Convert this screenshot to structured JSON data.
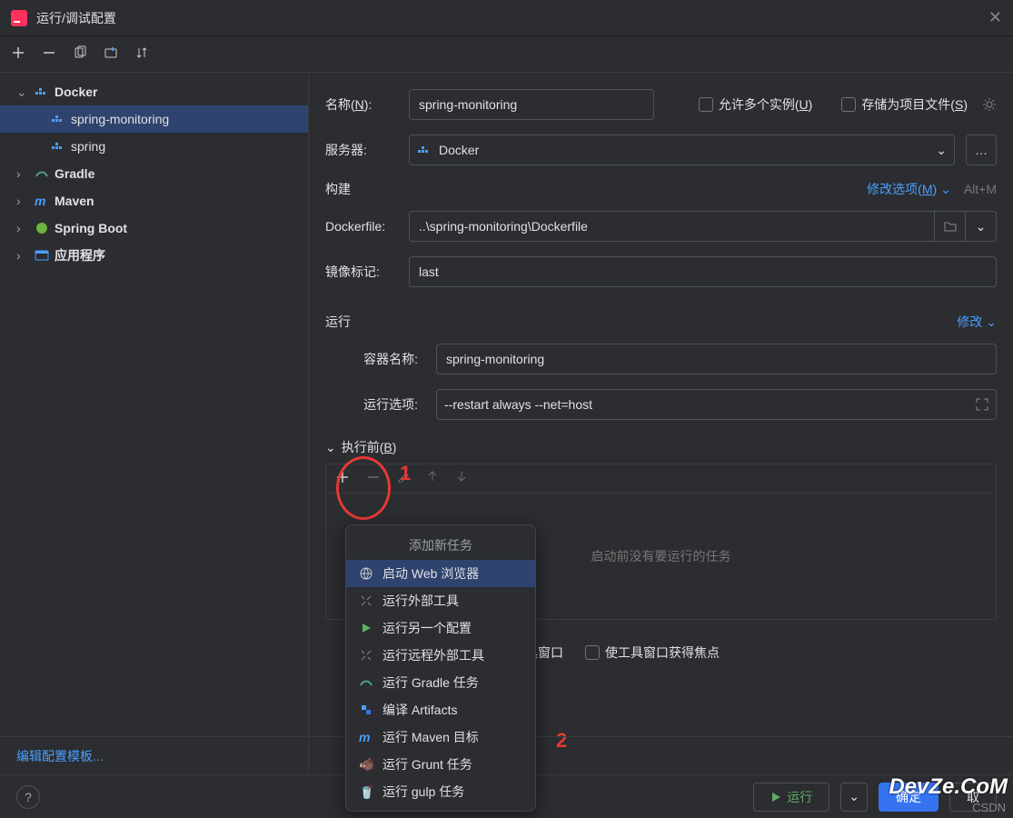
{
  "title": "运行/调试配置",
  "toolbar": {},
  "tree": {
    "docker": "Docker",
    "docker_children": [
      "spring-monitoring",
      "spring"
    ],
    "gradle": "Gradle",
    "maven": "Maven",
    "springboot": "Spring Boot",
    "app": "应用程序"
  },
  "form": {
    "name_label": "名称(",
    "name_key": "N",
    "name_value": "spring-monitoring",
    "allow_multi": "允许多个实例(",
    "allow_multi_key": "U",
    "store_project": "存储为项目文件(",
    "store_project_key": "S",
    "server_label": "服务器:",
    "server_value": "Docker",
    "build_section": "构建",
    "modify_options": "修改选项(",
    "modify_key": "M",
    "modify_shortcut": "Alt+M",
    "dockerfile_label": "Dockerfile:",
    "dockerfile_value": "..\\spring-monitoring\\Dockerfile",
    "image_tag_label": "镜像标记:",
    "image_tag_value": "last",
    "run_section": "运行",
    "modify2": "修改",
    "container_label": "容器名称:",
    "container_value": "spring-monitoring",
    "runopts_label": "运行选项:",
    "runopts_value": "--restart always --net=host",
    "before_label": "执行前(",
    "before_key": "B",
    "before_empty": "启动前没有要运行的任务",
    "open_tool_window": "具窗口",
    "focus_tool_window": "使工具窗口获得焦点"
  },
  "popup": {
    "title": "添加新任务",
    "items": [
      "启动 Web 浏览器",
      "运行外部工具",
      "运行另一个配置",
      "运行远程外部工具",
      "运行 Gradle 任务",
      "编译 Artifacts",
      "运行 Maven 目标",
      "运行 Grunt 任务",
      "运行 gulp 任务"
    ]
  },
  "bottom": {
    "edit_templates": "编辑配置模板..."
  },
  "buttons": {
    "run": "运行",
    "ok": "确定",
    "cancel": "取"
  },
  "annotations": {
    "one": "1",
    "two": "2"
  },
  "watermark": "CSDN",
  "logo": "DevZe.CoM"
}
